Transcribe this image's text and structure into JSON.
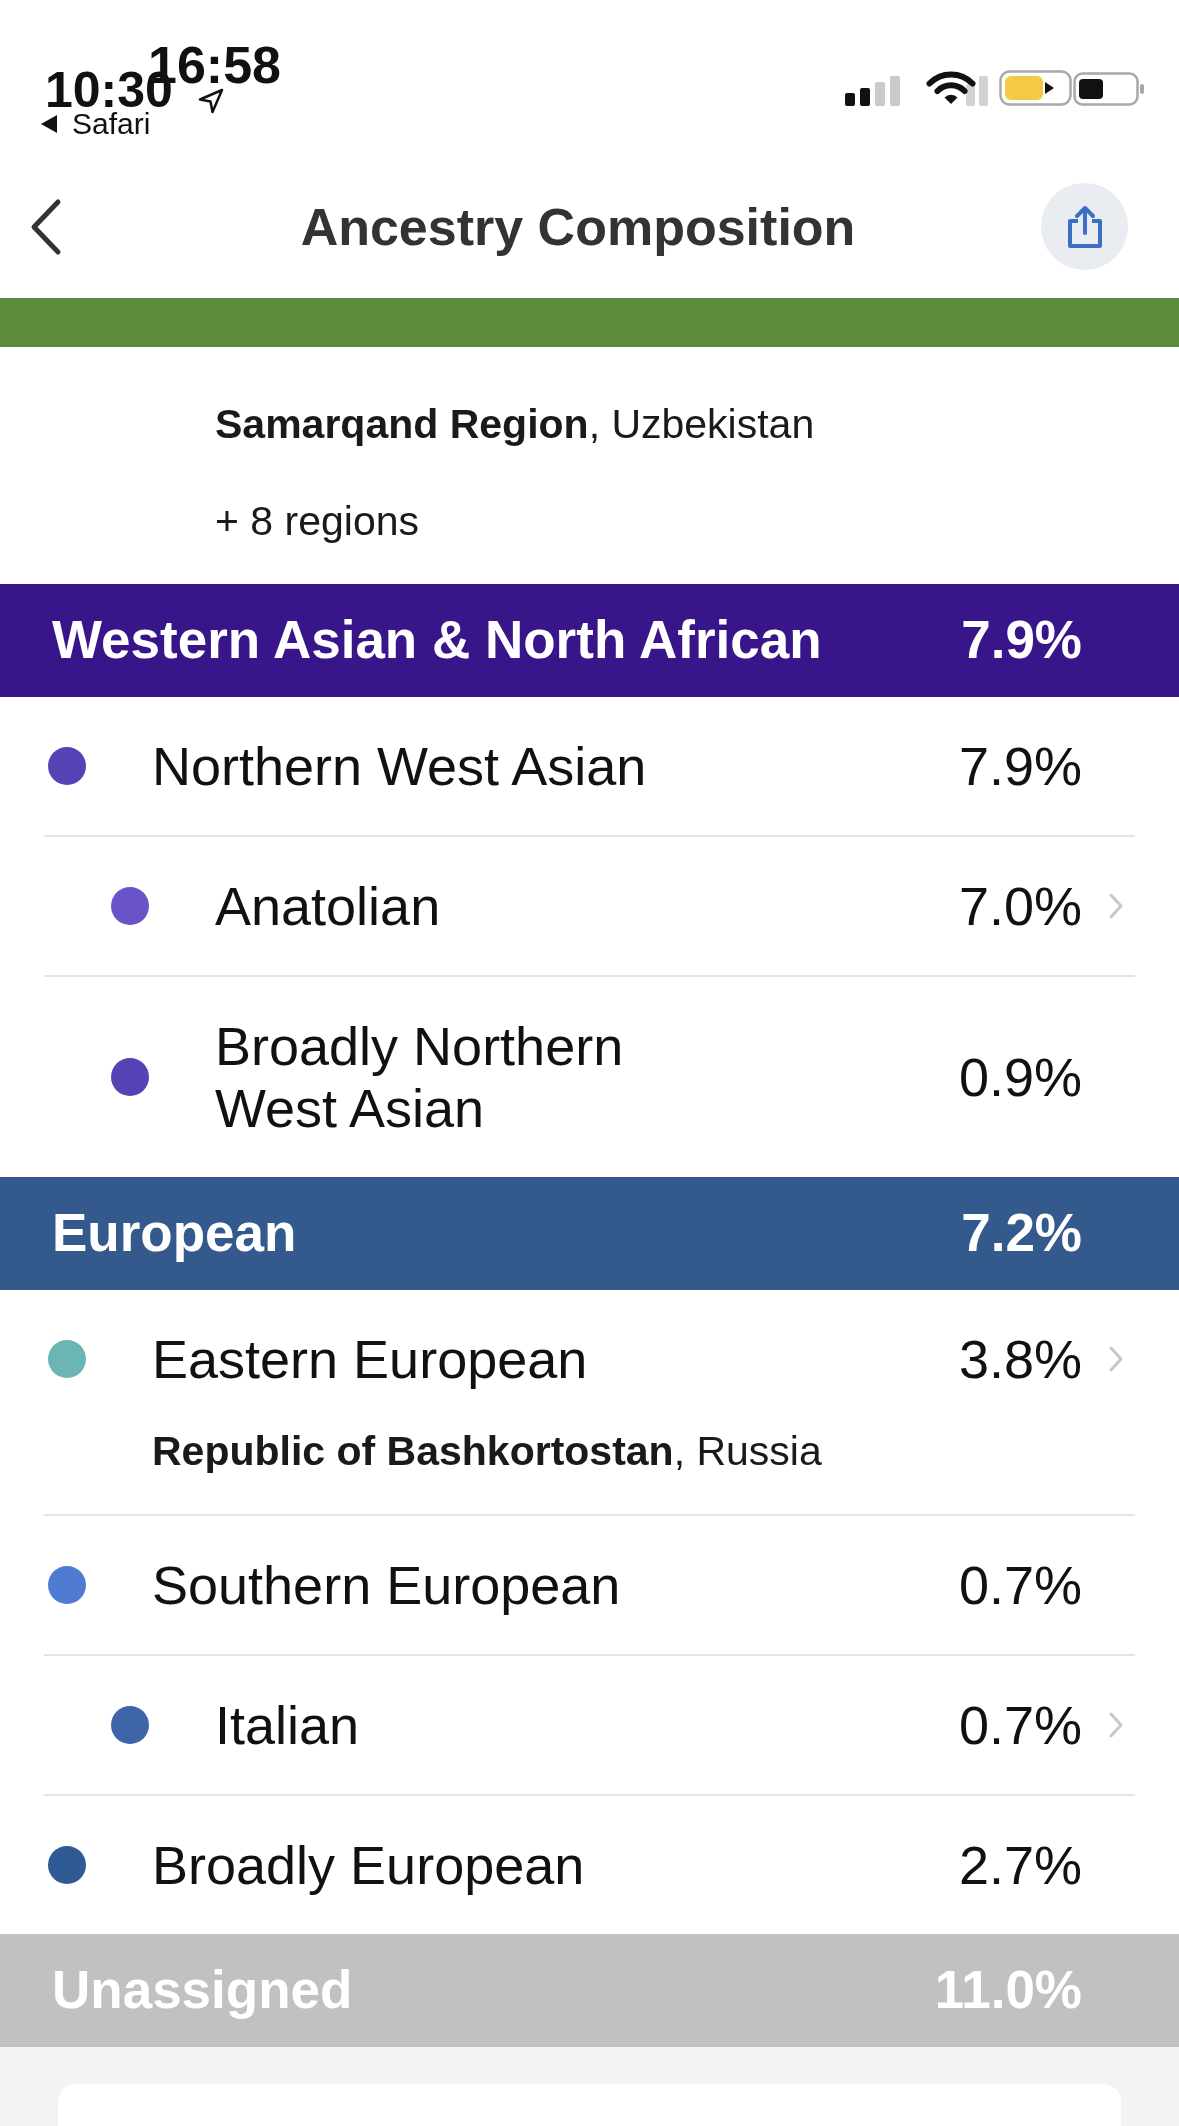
{
  "status_bar": {
    "time_behind": "10:30",
    "time": "16:58",
    "back_app": "Safari"
  },
  "header": {
    "title": "Ancestry Composition"
  },
  "groups": [
    {
      "color": "#5e8a3b",
      "continued": {
        "region": "**Samarqand Region**, Uzbekistan",
        "more": "+ 8 regions"
      }
    },
    {
      "name": "Western Asian & North African",
      "percent": "7.9%",
      "color": "#38168a",
      "rows": [
        {
          "name": "Northern West Asian",
          "percent": "7.9%",
          "color": "#5443b5",
          "chevron": false,
          "children": [
            {
              "name": "Anatolian",
              "percent": "7.0%",
              "color": "#6a53c9",
              "chevron": true
            },
            {
              "name": "Broadly Northern West Asian",
              "percent": "0.9%",
              "color": "#5443b5",
              "chevron": false
            }
          ]
        }
      ]
    },
    {
      "name": "European",
      "percent": "7.2%",
      "color": "#345a8d",
      "rows": [
        {
          "name": "Eastern European",
          "percent": "3.8%",
          "color": "#6cb5b5",
          "chevron": true,
          "region": "**Republic of Bashkortostan**, Russia"
        },
        {
          "name": "Southern European",
          "percent": "0.7%",
          "color": "#4f7bd2",
          "chevron": false,
          "children": [
            {
              "name": "Italian",
              "percent": "0.7%",
              "color": "#3e64aa",
              "chevron": true
            }
          ]
        },
        {
          "name": "Broadly European",
          "percent": "2.7%",
          "color": "#2f5a94",
          "chevron": false
        }
      ]
    },
    {
      "name": "Unassigned",
      "percent": "11.0%",
      "color": "#c1c1c1"
    }
  ]
}
